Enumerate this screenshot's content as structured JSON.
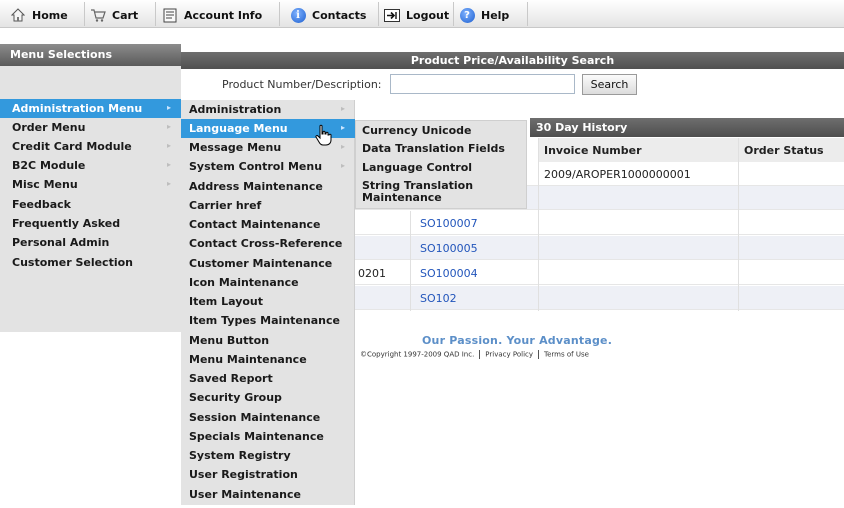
{
  "topnav": {
    "items": [
      {
        "label": "Home",
        "icon": "home-icon"
      },
      {
        "label": "Cart",
        "icon": "cart-icon"
      },
      {
        "label": "Account Info",
        "icon": "account-icon"
      },
      {
        "label": "Contacts",
        "icon": "info-icon"
      },
      {
        "label": "Logout",
        "icon": "logout-icon"
      },
      {
        "label": "Help",
        "icon": "help-icon"
      }
    ]
  },
  "sidebar": {
    "header": "Menu Selections",
    "items": [
      {
        "label": "Administration Menu",
        "has_submenu": true
      },
      {
        "label": "Order Menu",
        "has_submenu": true
      },
      {
        "label": "Credit Card Module",
        "has_submenu": true
      },
      {
        "label": "B2C Module",
        "has_submenu": true
      },
      {
        "label": "Misc Menu",
        "has_submenu": true
      },
      {
        "label": "Feedback",
        "has_submenu": false
      },
      {
        "label": "Frequently Asked",
        "has_submenu": false
      },
      {
        "label": "Personal Admin",
        "has_submenu": false
      },
      {
        "label": "Customer Selection",
        "has_submenu": false
      }
    ]
  },
  "search": {
    "title": "Product Price/Availability Search",
    "label": "Product Number/Description:",
    "value": "",
    "button": "Search"
  },
  "submenu_admin": {
    "items": [
      {
        "label": "Administration",
        "has_submenu": true
      },
      {
        "label": "Language Menu",
        "has_submenu": true
      },
      {
        "label": "Message Menu",
        "has_submenu": true
      },
      {
        "label": "System Control Menu",
        "has_submenu": true
      },
      {
        "label": "Address Maintenance"
      },
      {
        "label": "Carrier href"
      },
      {
        "label": "Contact Maintenance"
      },
      {
        "label": "Contact Cross-Reference"
      },
      {
        "label": "Customer Maintenance"
      },
      {
        "label": "Icon Maintenance"
      },
      {
        "label": "Item Layout"
      },
      {
        "label": "Item Types Maintenance"
      },
      {
        "label": "Menu Button"
      },
      {
        "label": "Menu Maintenance"
      },
      {
        "label": "Saved Report"
      },
      {
        "label": "Security Group"
      },
      {
        "label": "Session Maintenance"
      },
      {
        "label": "Specials Maintenance"
      },
      {
        "label": "System Registry"
      },
      {
        "label": "User Registration"
      },
      {
        "label": "User Maintenance"
      }
    ]
  },
  "submenu_language": {
    "items": [
      {
        "label": "Currency Unicode"
      },
      {
        "label": "Data Translation Fields"
      },
      {
        "label": "Language Control"
      },
      {
        "label": "String Translation Maintenance"
      }
    ]
  },
  "history": {
    "title": "30 Day History",
    "columns": [
      "Invoice Number",
      "Order Status"
    ],
    "rows": [
      {
        "prefix": "",
        "order": "",
        "invoice": "2009/AROPER1000000001",
        "status": ""
      },
      {
        "prefix": "",
        "order": "",
        "invoice": "",
        "status": ""
      },
      {
        "prefix": "",
        "order": "SO100007",
        "invoice": "",
        "status": ""
      },
      {
        "prefix": "",
        "order": "SO100005",
        "invoice": "",
        "status": ""
      },
      {
        "prefix": "0201",
        "order": "SO100004",
        "invoice": "",
        "status": ""
      },
      {
        "prefix": "",
        "order": "SO102",
        "invoice": "",
        "status": ""
      }
    ]
  },
  "footer": {
    "tagline": "Our Passion. Your Advantage.",
    "copyright": "©Copyright 1997-2009 QAD Inc.",
    "privacy": "Privacy Policy",
    "terms": "Terms of Use"
  }
}
